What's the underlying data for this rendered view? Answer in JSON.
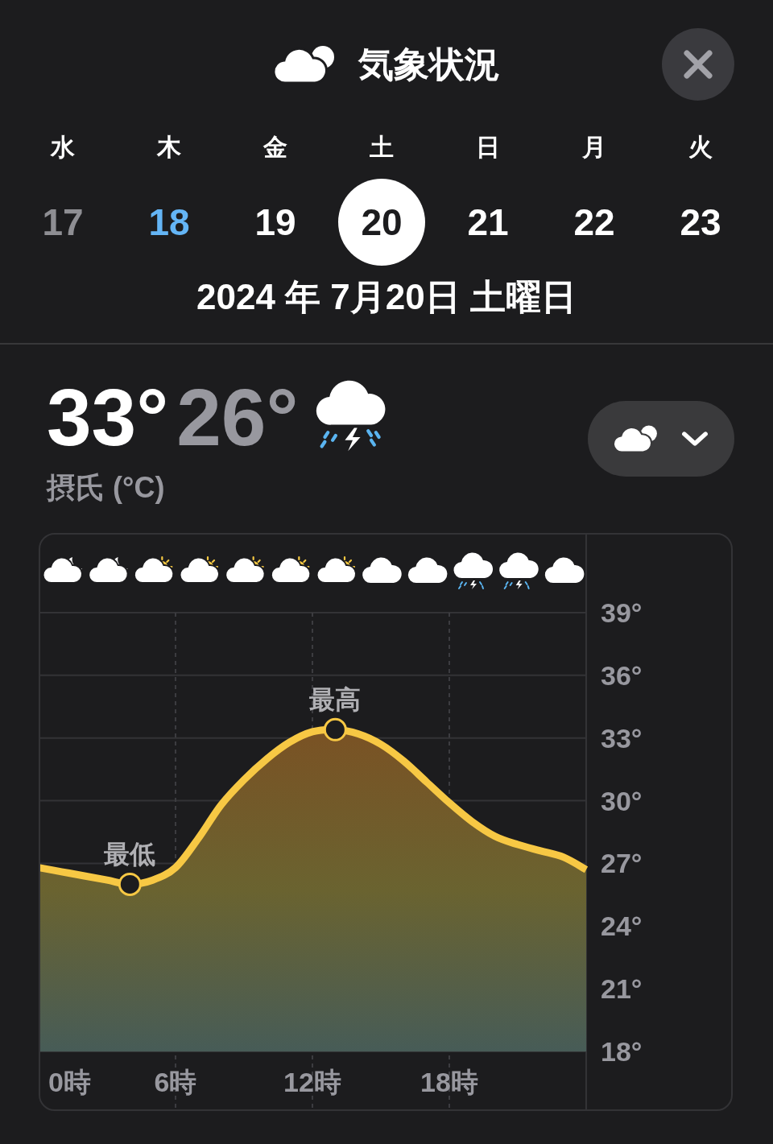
{
  "header": {
    "title": "気象状況"
  },
  "days": [
    {
      "weekday": "水",
      "day": "17",
      "kind": "past",
      "selected": false
    },
    {
      "weekday": "木",
      "day": "18",
      "kind": "today",
      "selected": false
    },
    {
      "weekday": "金",
      "day": "19",
      "kind": "future",
      "selected": false
    },
    {
      "weekday": "土",
      "day": "20",
      "kind": "future",
      "selected": true
    },
    {
      "weekday": "日",
      "day": "21",
      "kind": "future",
      "selected": false
    },
    {
      "weekday": "月",
      "day": "22",
      "kind": "future",
      "selected": false
    },
    {
      "weekday": "火",
      "day": "23",
      "kind": "future",
      "selected": false
    }
  ],
  "selected_date": "2024 年 7月20日 土曜日",
  "summary": {
    "high": "33°",
    "low": "26°",
    "condition": {
      "kind": "thunderstorm"
    },
    "unit": "摂氏 (°C)"
  },
  "forecast_chart": {
    "condition_icons": [
      {
        "kind": "partly-cloudy-night"
      },
      {
        "kind": "partly-cloudy-night"
      },
      {
        "kind": "partly-sunny"
      },
      {
        "kind": "partly-sunny"
      },
      {
        "kind": "partly-sunny"
      },
      {
        "kind": "partly-sunny"
      },
      {
        "kind": "partly-sunny"
      },
      {
        "kind": "cloudy"
      },
      {
        "kind": "cloudy"
      },
      {
        "kind": "thunderstorm"
      },
      {
        "kind": "thunderstorm"
      },
      {
        "kind": "cloudy"
      }
    ],
    "chart_data": {
      "type": "area",
      "x": [
        0,
        1,
        2,
        3,
        4,
        5,
        6,
        7,
        8,
        9,
        10,
        11,
        12,
        13,
        14,
        15,
        16,
        17,
        18,
        19,
        20,
        21,
        22,
        23,
        24
      ],
      "series": [
        {
          "color": "#f7c844",
          "values": [
            26.8,
            26.6,
            26.4,
            26.2,
            26.0,
            26.2,
            26.8,
            28.2,
            29.8,
            31.0,
            32.0,
            32.8,
            33.3,
            33.4,
            33.2,
            32.7,
            31.9,
            30.9,
            29.9,
            29.0,
            28.3,
            27.9,
            27.6,
            27.3,
            26.7
          ]
        }
      ],
      "xlim": [
        0,
        24
      ],
      "ylim": [
        18,
        39
      ],
      "grid": true,
      "xticks": [
        {
          "value": 0,
          "label": "0時"
        },
        {
          "value": 6,
          "label": "6時"
        },
        {
          "value": 12,
          "label": "12時"
        },
        {
          "value": 18,
          "label": "18時"
        }
      ],
      "yticks": [
        {
          "value": 18,
          "label": "18°"
        },
        {
          "value": 21,
          "label": "21°"
        },
        {
          "value": 24,
          "label": "24°"
        },
        {
          "value": 27,
          "label": "27°"
        },
        {
          "value": 30,
          "label": "30°"
        },
        {
          "value": 33,
          "label": "33°"
        },
        {
          "value": 36,
          "label": "36°"
        },
        {
          "value": 39,
          "label": "39°"
        }
      ],
      "annotations": [
        {
          "x": 4,
          "y": 26.0,
          "text": "最低"
        },
        {
          "x": 13,
          "y": 33.4,
          "text": "最高"
        }
      ]
    }
  }
}
